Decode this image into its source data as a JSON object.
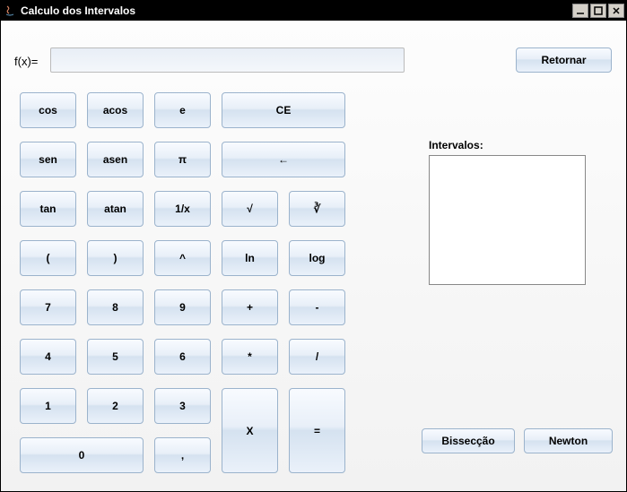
{
  "window": {
    "title": "Calculo dos Intervalos"
  },
  "fx": {
    "label": "f(x)=",
    "value": ""
  },
  "buttons": {
    "retornar": "Retornar",
    "cos": "cos",
    "acos": "acos",
    "e": "e",
    "ce": "CE",
    "sen": "sen",
    "asen": "asen",
    "pi": "π",
    "back": "←",
    "tan": "tan",
    "atan": "atan",
    "oneoverx": "1/x",
    "sqrt": "√",
    "cbrt": "∛",
    "lparen": "(",
    "rparen": ")",
    "caret": "^",
    "ln": "ln",
    "log": "log",
    "7": "7",
    "8": "8",
    "9": "9",
    "plus": "+",
    "minus": "-",
    "4": "4",
    "5": "5",
    "6": "6",
    "mult": "*",
    "div": "/",
    "1": "1",
    "2": "2",
    "3": "3",
    "x": "X",
    "eq": "=",
    "0": "0",
    "comma": ",",
    "bisseccao": "Bissecção",
    "newton": "Newton"
  },
  "intervals": {
    "label": "Intervalos:"
  }
}
